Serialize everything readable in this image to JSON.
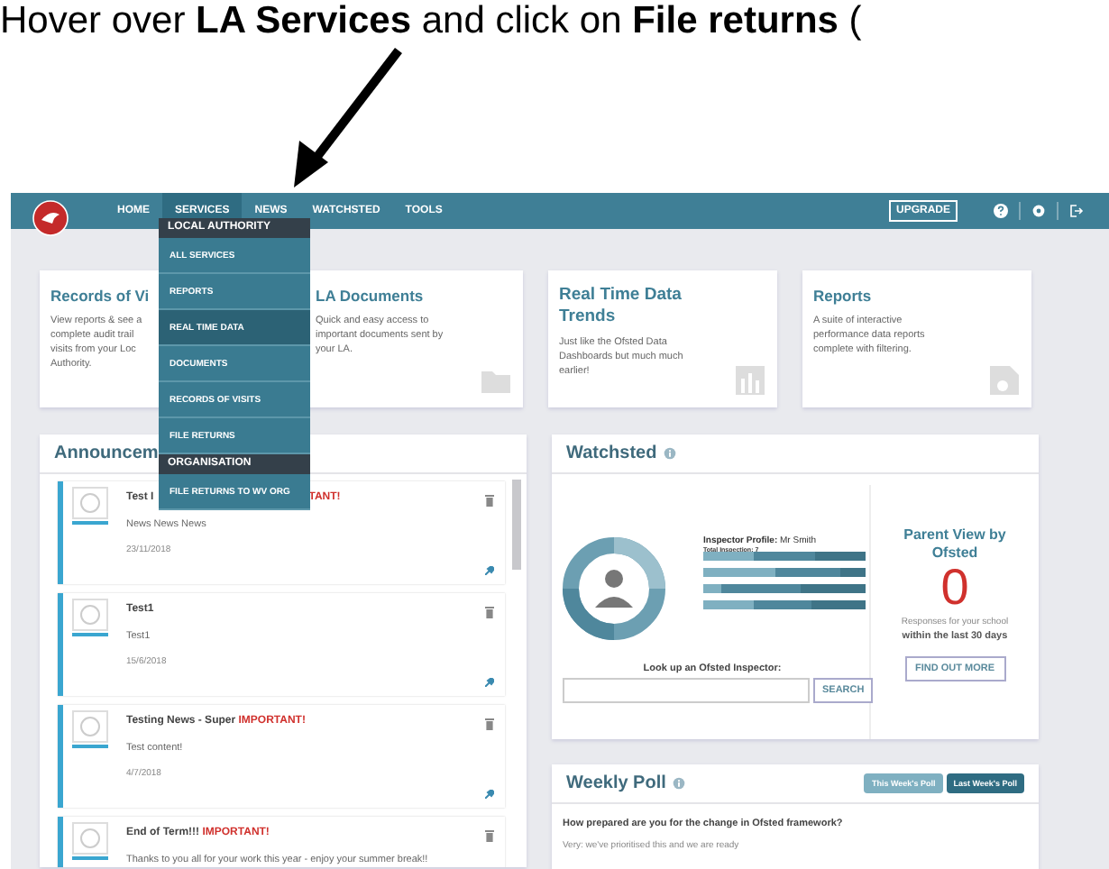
{
  "caption": "Hover over **LA Services** and click on **File returns** (",
  "nav": {
    "items": [
      {
        "label": "HOME",
        "selected": false
      },
      {
        "label": "SERVICES",
        "selected": true
      },
      {
        "label": "NEWS",
        "selected": false
      },
      {
        "label": "WATCHSTED",
        "selected": false
      },
      {
        "label": "TOOLS",
        "selected": false
      }
    ],
    "upgrade": "UPGRADE"
  },
  "menu": [
    {
      "kind": "header",
      "label": "LOCAL AUTHORITY"
    },
    {
      "kind": "item",
      "label": "ALL SERVICES",
      "hovered": false
    },
    {
      "kind": "item",
      "label": "REPORTS",
      "hovered": false
    },
    {
      "kind": "item",
      "label": "REAL TIME DATA",
      "hovered": true
    },
    {
      "kind": "item",
      "label": "DOCUMENTS",
      "hovered": false
    },
    {
      "kind": "item",
      "label": "RECORDS OF VISITS",
      "hovered": false
    },
    {
      "kind": "item",
      "label": "FILE RETURNS",
      "hovered": false
    },
    {
      "kind": "header",
      "label": "ORGANISATION"
    },
    {
      "kind": "item",
      "label": "FILE RETURNS TO WV ORG",
      "hovered": false
    }
  ],
  "cards": [
    {
      "title": "Records of Vi",
      "lines": [
        "View reports & see a",
        "complete audit trail",
        "visits from your Loc",
        "Authority."
      ]
    },
    {
      "title": "LA Documents",
      "lines": [
        "Quick and easy access to",
        "important documents sent by",
        "your LA."
      ]
    },
    {
      "title": "Real Time Data Trends",
      "lines": [
        "Just like the Ofsted Data",
        "Dashboards but much much",
        "earlier!"
      ]
    },
    {
      "title": "Reports",
      "lines": [
        "A suite of interactive",
        "performance data reports",
        "complete with filtering."
      ]
    }
  ],
  "announcements": {
    "title": "Announcem",
    "items": [
      {
        "title": "Test I",
        "important": "TANT!",
        "body": "News News News",
        "date": "23/11/2018"
      },
      {
        "title": "Test1",
        "body": "Test1",
        "date": "15/6/2018"
      },
      {
        "title": "Testing News - Super ",
        "important": "IMPORTANT!",
        "body": "Test content!",
        "date": "4/7/2018"
      },
      {
        "title": "End of Term!!! ",
        "important": "IMPORTANT!",
        "body": "Thanks to you all for your work this year - enjoy your summer break!!"
      }
    ]
  },
  "watchsted": {
    "title": "Watchsted",
    "profile_label": "Inspector Profile:",
    "profile_name": "Mr Smith",
    "total": "Total Inspection: 7",
    "lookup": "Look up an Ofsted Inspector:",
    "search": "SEARCH",
    "parent_title": "Parent View by Ofsted",
    "count": "0",
    "responses": "Responses for your school",
    "within": "within the last 30 days",
    "find": "FIND OUT MORE"
  },
  "poll": {
    "title": "Weekly Poll",
    "tabs": [
      {
        "label": "This Week's Poll",
        "selected": false
      },
      {
        "label": "Last Week's Poll",
        "selected": true
      }
    ],
    "question": "How prepared are you for the change in Ofsted framework?",
    "option": "Very: we've prioritised this and we are ready"
  }
}
